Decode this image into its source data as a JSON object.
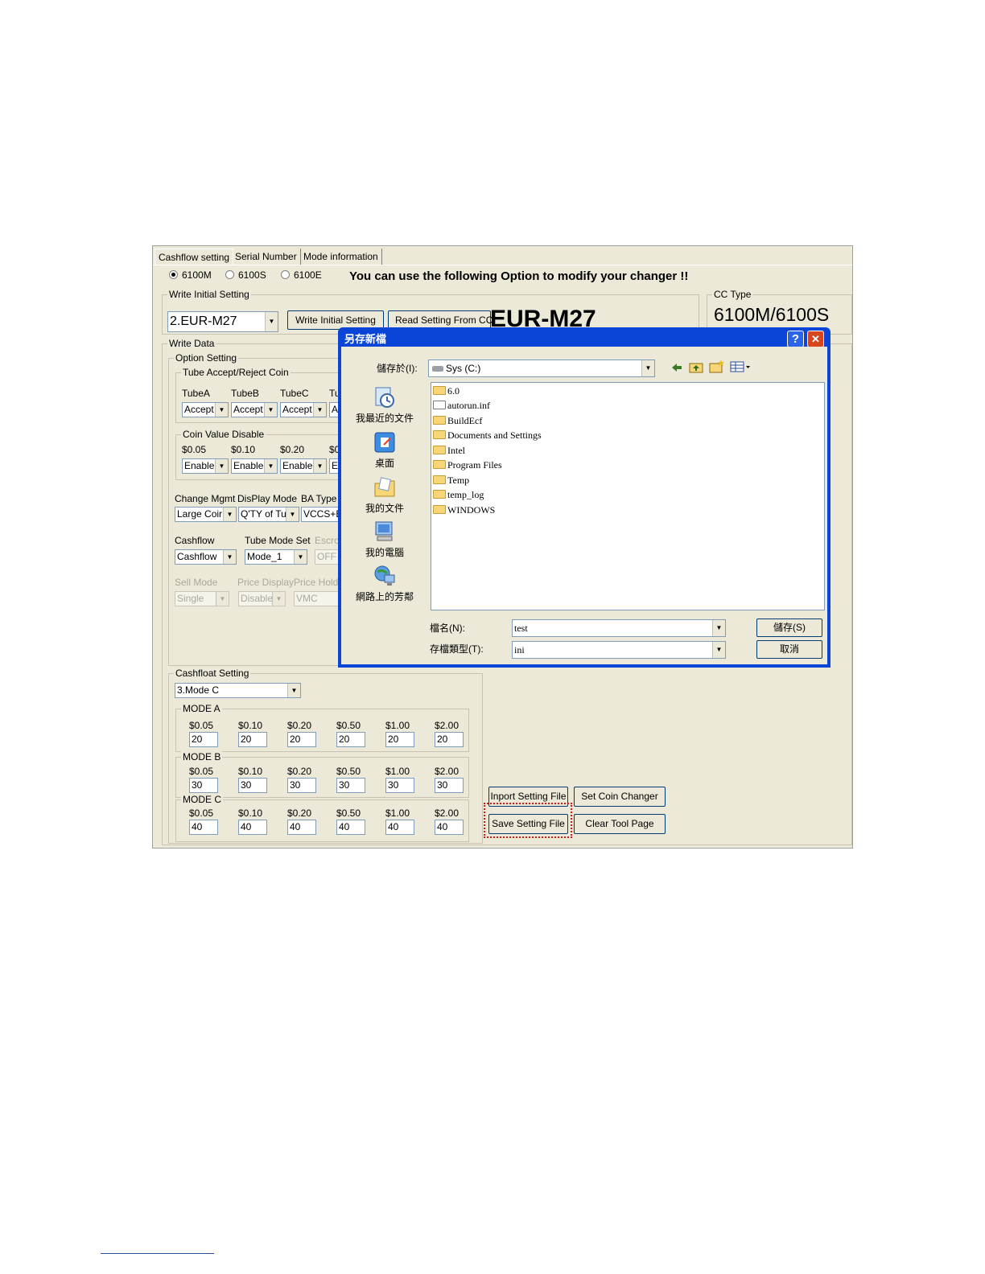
{
  "tabs": [
    "Cashflow setting",
    "Serial Number",
    "Mode information"
  ],
  "model_radios": [
    {
      "label": "6100M",
      "selected": true
    },
    {
      "label": "6100S",
      "selected": false
    },
    {
      "label": "6100E",
      "selected": false
    }
  ],
  "banner": "You can use the following Option to modify your changer !!",
  "write_initial": {
    "group": "Write Initial Setting",
    "select_value": "2.EUR-M27",
    "write_button": "Write Initial Setting",
    "read_button": "Read Setting From CC",
    "big_label": "EUR-M27"
  },
  "cc_type": {
    "group": "CC Type",
    "value": "6100M/6100S"
  },
  "write_data": {
    "group": "Write Data",
    "option_group": "Option Setting",
    "tube_group": "Tube Accept/Reject Coin",
    "tube_labels": [
      "TubeA",
      "TubeB",
      "TubeC",
      "Tu"
    ],
    "tube_values": [
      "Accept",
      "Accept",
      "Accept",
      "A"
    ],
    "coin_group": "Coin Value Disable",
    "coin_labels": [
      "$0.05",
      "$0.10",
      "$0.20",
      "$0"
    ],
    "coin_values": [
      "Enable",
      "Enable",
      "Enable",
      "E"
    ],
    "mgmt_labels": [
      "Change Mgmt",
      "DisPlay Mode",
      "BA Type"
    ],
    "mgmt_values": [
      "Large Coir",
      "Q'TY of Tu",
      "VCCS+E"
    ],
    "cashflow_labels": [
      "Cashflow",
      "Tube Mode Set",
      "Escro"
    ],
    "cashflow_values": [
      "Cashflow",
      "Mode_1",
      "OFF"
    ],
    "sell_labels": [
      "Sell Mode",
      "Price Display",
      "Price Hold"
    ],
    "sell_values": [
      "Single",
      "Disable",
      "VMC"
    ]
  },
  "cashfloat": {
    "group": "Cashfloat Setting",
    "select_value": "3.Mode C",
    "denoms": [
      "$0.05",
      "$0.10",
      "$0.20",
      "$0.50",
      "$1.00",
      "$2.00"
    ],
    "modes": [
      {
        "name": "MODE A",
        "values": [
          "20",
          "20",
          "20",
          "20",
          "20",
          "20"
        ]
      },
      {
        "name": "MODE B",
        "values": [
          "30",
          "30",
          "30",
          "30",
          "30",
          "30"
        ]
      },
      {
        "name": "MODE C",
        "values": [
          "40",
          "40",
          "40",
          "40",
          "40",
          "40"
        ]
      }
    ]
  },
  "actions": {
    "import": "Inport Setting File",
    "set_changer": "Set  Coin Changer",
    "save": "Save Setting File",
    "clear": "Clear Tool Page"
  },
  "dialog": {
    "title": "另存新檔",
    "help": "?",
    "close": "✕",
    "save_in_label": "儲存於(I):",
    "save_in_value": "Sys (C:)",
    "places": [
      "我最近的文件",
      "桌面",
      "我的文件",
      "我的電腦",
      "網路上的芳鄰"
    ],
    "files": [
      "6.0",
      "autorun.inf",
      "BuildEcf",
      "Documents and Settings",
      "Intel",
      "Program Files",
      "Temp",
      "temp_log",
      "WINDOWS"
    ],
    "filename_label": "檔名(N):",
    "filename_value": "test",
    "filetype_label": "存檔類型(T):",
    "filetype_value": "ini",
    "save_button": "儲存(S)",
    "cancel_button": "取消"
  }
}
